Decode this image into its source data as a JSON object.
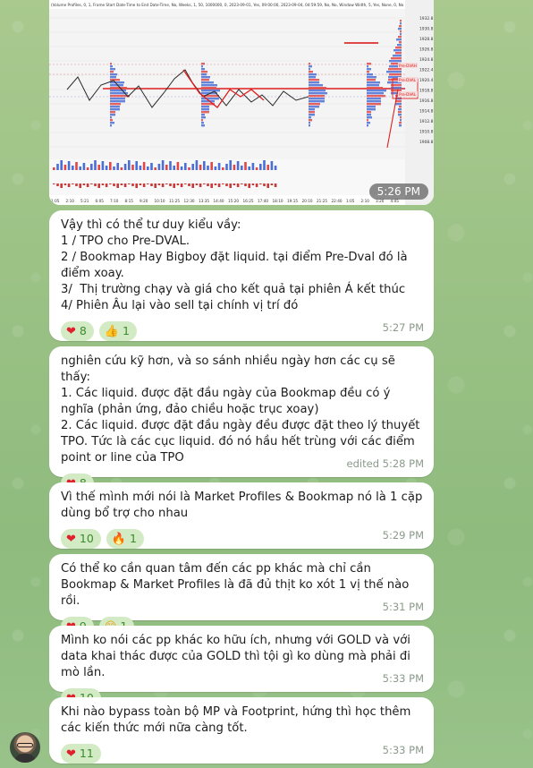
{
  "chart_image": {
    "header_text": "(Volume Profiles, 0, 1, Frame Start Date-Time to End Date-Time, No, Weeks, 1, 50, 1000000, 0, 2023-09-01, Yes, 09:00:00, 2023-09-04, 04:59:59, No, No, Window Width, 5, Yes, None, 0, No",
    "price_labels": [
      "1932.8",
      "1930.8",
      "1928.8",
      "1926.8",
      "1924.8",
      "1922.4",
      "1920.4",
      "1918.8",
      "1916.8",
      "1914.8",
      "1912.8",
      "1910.8",
      "1908.8"
    ],
    "markers": [
      "Pre-DVAH",
      "Pre-DVAL",
      "Pre-DVAL"
    ],
    "time_labels": [
      "1:05",
      "2:10",
      "5:21",
      "6:05",
      "7:10",
      "8:15",
      "9:20",
      "10:10",
      "11:25",
      "12:30",
      "13:35",
      "14:40",
      "15:20",
      "16:25",
      "17:40",
      "18:10",
      "19:15",
      "20:10",
      "21:25",
      "22:40",
      "1:05",
      "2:10",
      "3:20",
      "4:05"
    ],
    "time": "5:26 PM"
  },
  "messages": [
    {
      "lines": [
        "Vậy thì có thể tư duy kiểu vầy:",
        "1 / TPO cho Pre-DVAL.",
        "2 / Bookmap Hay Bigboy đặt liquid. tại điểm Pre-Dval đó là điểm xoay.",
        "3/  Thị trường chạy và giá cho kết quả tại phiên Á kết thúc",
        "4/ Phiên Âu lại vào sell tại chính vị trí đó"
      ],
      "reactions": [
        {
          "emoji": "❤",
          "icon": "heart-icon",
          "count": "8"
        },
        {
          "emoji": "👍",
          "icon": "thumbs-up-icon",
          "count": "1"
        }
      ],
      "time": "5:27 PM"
    },
    {
      "lines": [
        "nghiên cứu kỹ hơn, và so sánh nhiều ngày hơn các cụ sẽ thấy:",
        "1. Các liquid. được đặt đầu ngày của Bookmap đều có ý nghĩa (phản ứng, đảo chiều hoặc trục xoay)",
        "2. Các liquid. được đặt đầu ngày đều được đặt theo lý thuyết TPO. Tức là các cục liquid. đó nó hầu hết trùng với các điểm point or line của TPO"
      ],
      "reactions": [
        {
          "emoji": "❤",
          "icon": "heart-icon",
          "count": "8"
        }
      ],
      "time": "edited 5:28 PM"
    },
    {
      "lines": [
        "Vì thế mình mới nói là Market Profiles & Bookmap nó là 1 cặp dùng bổ trợ cho nhau"
      ],
      "reactions": [
        {
          "emoji": "❤",
          "icon": "heart-icon",
          "count": "10"
        },
        {
          "emoji": "🔥",
          "icon": "fire-icon",
          "count": "1"
        }
      ],
      "time": "5:29 PM"
    },
    {
      "lines": [
        "Có thể ko cần quan tâm đến các pp khác mà chỉ cần Bookmap & Market Profiles là đã đủ thịt ko xót 1 vị thế nào rồi."
      ],
      "reactions": [
        {
          "emoji": "❤",
          "icon": "heart-icon",
          "count": "9"
        },
        {
          "emoji": "😁",
          "icon": "grin-icon",
          "count": "1"
        }
      ],
      "time": "5:31 PM"
    },
    {
      "lines": [
        "Mình ko nói các pp khác ko hữu ích, nhưng với GOLD và với data khai thác được của GOLD thì tội gì ko dùng mà phải đi mò lần."
      ],
      "reactions": [
        {
          "emoji": "❤",
          "icon": "heart-icon",
          "count": "10"
        }
      ],
      "time": "5:33 PM"
    },
    {
      "lines": [
        "Khi nào bypass toàn bộ MP và Footprint, hứng thì học thêm các kiến thức mới nữa càng tốt."
      ],
      "reactions": [
        {
          "emoji": "❤",
          "icon": "heart-icon",
          "count": "11"
        }
      ],
      "time": "5:33 PM"
    }
  ]
}
